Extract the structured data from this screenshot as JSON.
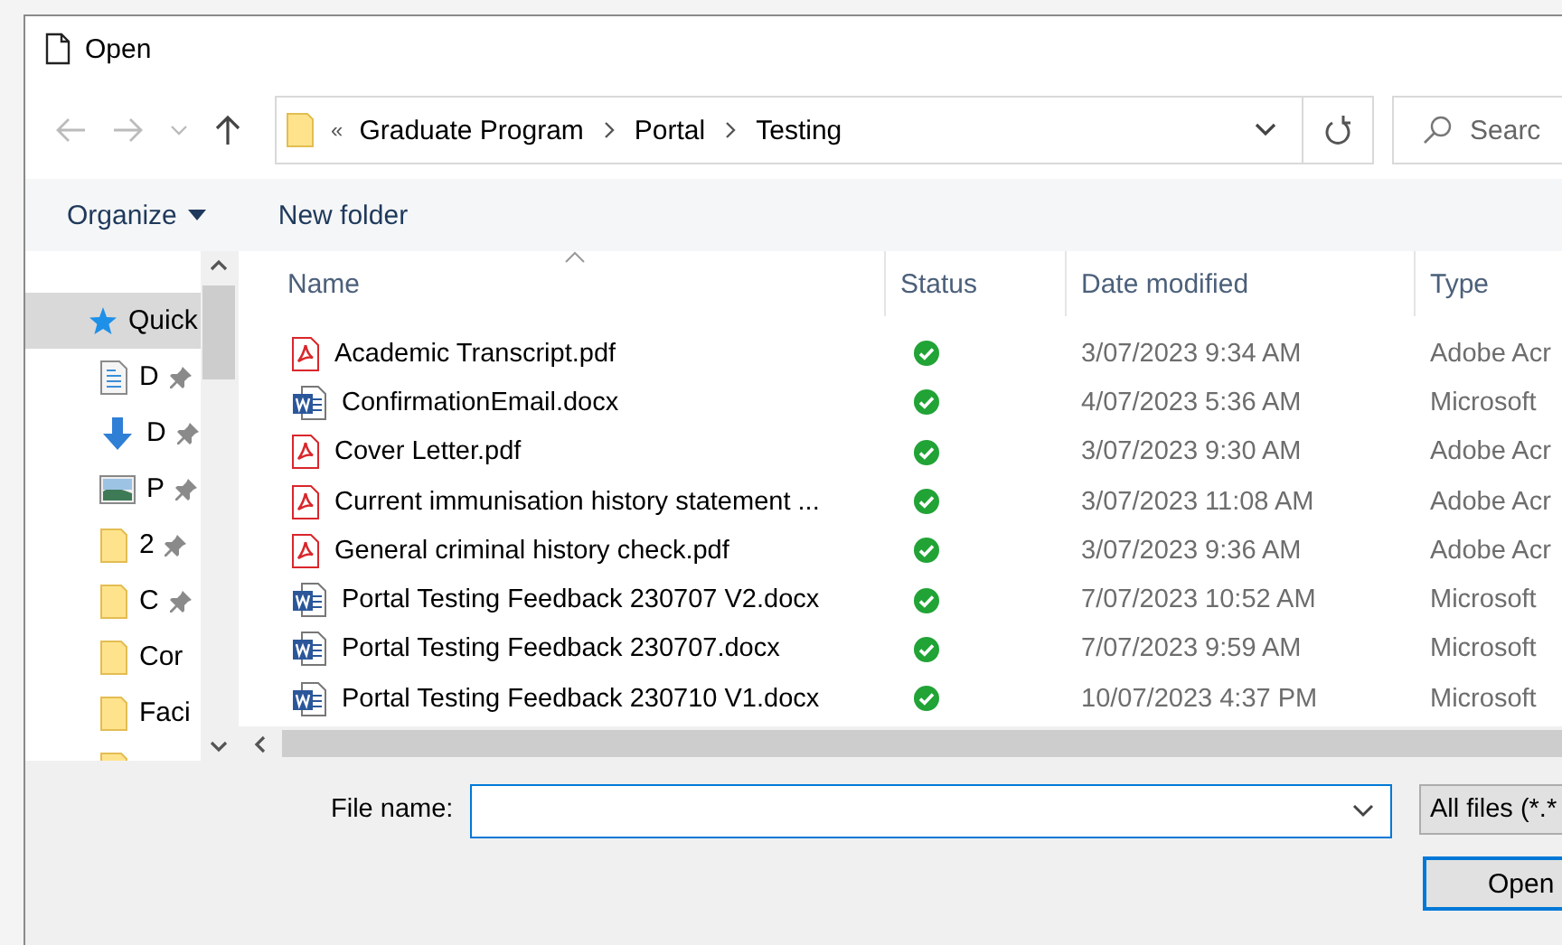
{
  "window": {
    "title": "Open"
  },
  "address": {
    "overflow": "«",
    "crumbs": [
      "Graduate Program",
      "Portal",
      "Testing"
    ]
  },
  "search": {
    "placeholder": "Searc"
  },
  "toolbar": {
    "organize": "Organize",
    "new_folder": "New folder"
  },
  "nav": [
    {
      "kind": "quick",
      "label": "Quick",
      "pinned": false,
      "selected": true
    },
    {
      "kind": "documents",
      "label": "D",
      "pinned": true,
      "selected": false
    },
    {
      "kind": "downloads",
      "label": "D",
      "pinned": true,
      "selected": false
    },
    {
      "kind": "pictures",
      "label": "P",
      "pinned": true,
      "selected": false
    },
    {
      "kind": "folder",
      "label": "2",
      "pinned": true,
      "selected": false
    },
    {
      "kind": "folder",
      "label": "C",
      "pinned": true,
      "selected": false
    },
    {
      "kind": "folder",
      "label": "Cor",
      "pinned": false,
      "selected": false
    },
    {
      "kind": "folder",
      "label": "Faci",
      "pinned": false,
      "selected": false
    }
  ],
  "table": {
    "columns": [
      "Name",
      "Status",
      "Date modified",
      "Type"
    ],
    "rows": [
      {
        "kind": "pdf",
        "name": "Academic Transcript.pdf",
        "synced": true,
        "date": "3/07/2023 9:34 AM",
        "type": "Adobe Acr"
      },
      {
        "kind": "word",
        "name": "ConfirmationEmail.docx",
        "synced": true,
        "date": "4/07/2023 5:36 AM",
        "type": "Microsoft"
      },
      {
        "kind": "pdf",
        "name": "Cover Letter.pdf",
        "synced": true,
        "date": "3/07/2023 9:30 AM",
        "type": "Adobe Acr"
      },
      {
        "kind": "pdf",
        "name": "Current immunisation history statement ...",
        "synced": true,
        "date": "3/07/2023 11:08 AM",
        "type": "Adobe Acr"
      },
      {
        "kind": "pdf",
        "name": "General criminal history check.pdf",
        "synced": true,
        "date": "3/07/2023 9:36 AM",
        "type": "Adobe Acr"
      },
      {
        "kind": "word",
        "name": "Portal Testing Feedback 230707 V2.docx",
        "synced": true,
        "date": "7/07/2023 10:52 AM",
        "type": "Microsoft"
      },
      {
        "kind": "word",
        "name": "Portal Testing Feedback 230707.docx",
        "synced": true,
        "date": "7/07/2023 9:59 AM",
        "type": "Microsoft"
      },
      {
        "kind": "word",
        "name": "Portal Testing Feedback 230710 V1.docx",
        "synced": true,
        "date": "10/07/2023 4:37 PM",
        "type": "Microsoft"
      }
    ]
  },
  "file_name": {
    "label": "File name:"
  },
  "filter": {
    "value": "All files (*.*"
  },
  "buttons": [
    "Open"
  ]
}
